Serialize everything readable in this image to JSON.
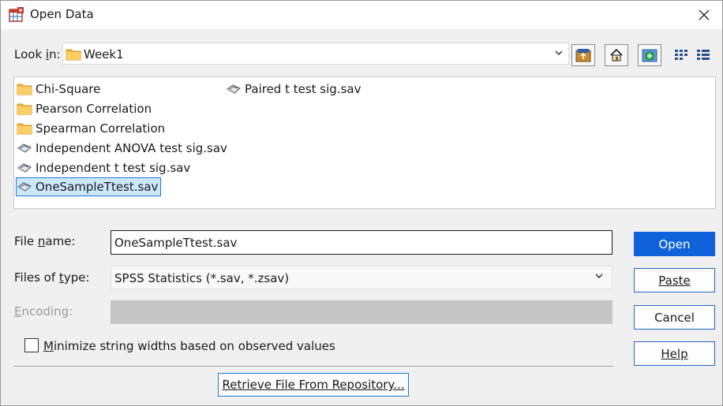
{
  "window": {
    "title": "Open Data"
  },
  "lookin": {
    "label": "Look in:",
    "value": "Week1"
  },
  "toolbar": {
    "up_icon": "folder-up-icon",
    "home_icon": "home-icon",
    "new_folder_icon": "new-folder-icon",
    "list_view_icon": "list-view-icon",
    "details_view_icon": "details-view-icon"
  },
  "files": [
    {
      "name": "Chi-Square",
      "kind": "folder"
    },
    {
      "name": "Pearson Correlation",
      "kind": "folder"
    },
    {
      "name": "Spearman Correlation",
      "kind": "folder"
    },
    {
      "name": "Independent ANOVA test sig.sav",
      "kind": "sav"
    },
    {
      "name": "Independent t test sig.sav",
      "kind": "sav"
    },
    {
      "name": "OneSampleTtest.sav",
      "kind": "sav",
      "selected": true
    },
    {
      "name": "Paired t test sig.sav",
      "kind": "sav"
    }
  ],
  "form": {
    "filename_label": "File name:",
    "filename_value": "OneSampleTtest.sav",
    "filetype_label": "Files of type:",
    "filetype_value": "SPSS Statistics (*.sav, *.zsav)",
    "encoding_label": "Encoding:",
    "minimize_label": "Minimize string widths based on observed values",
    "minimize_checked": false,
    "retrieve_label": "Retrieve File From Repository..."
  },
  "buttons": {
    "open": "Open",
    "paste": "Paste",
    "cancel": "Cancel",
    "help": "Help"
  },
  "colors": {
    "primary": "#0f62d9",
    "selection": "#cce8ff",
    "folder": "#f5b73b"
  }
}
